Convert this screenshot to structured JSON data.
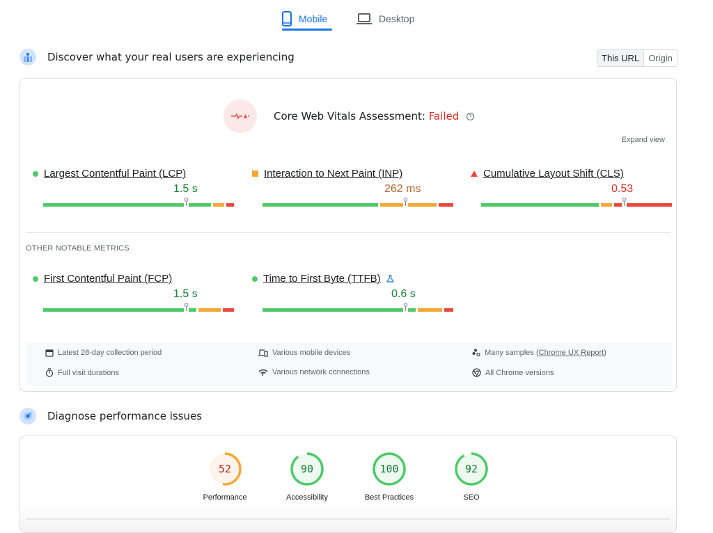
{
  "tabs": [
    {
      "label": "Mobile",
      "icon": "smartphone-icon",
      "active": true
    },
    {
      "label": "Desktop",
      "icon": "laptop-icon",
      "active": false
    }
  ],
  "field_section": {
    "title": "Discover what your real users are experiencing",
    "toggle": [
      {
        "label": "This URL",
        "active": true
      },
      {
        "label": "Origin",
        "active": false
      }
    ],
    "assessment": {
      "prefix": "Core Web Vitals Assessment:",
      "status": "Failed",
      "status_color": "#d93025"
    },
    "expand_label": "Expand view",
    "core_metrics": [
      {
        "name": "Largest Contentful Paint (LCP)",
        "value": "1.5 s",
        "rating": "good",
        "color": "#188038",
        "distribution": {
          "good_pct": 90,
          "ni_pct": 6,
          "poor_pct": 4
        },
        "marker_pct": 75
      },
      {
        "name": "Interaction to Next Paint (INP)",
        "value": "262 ms",
        "rating": "needs-improvement",
        "color": "#b7652c",
        "distribution": {
          "good_pct": 62,
          "ni_pct": 30,
          "poor_pct": 8
        },
        "marker_pct": 75
      },
      {
        "name": "Cumulative Layout Shift (CLS)",
        "value": "0.53",
        "rating": "poor",
        "color": "#d93025",
        "distribution": {
          "good_pct": 63,
          "ni_pct": 6,
          "poor_pct": 31
        },
        "marker_pct": 75
      }
    ],
    "other_heading": "OTHER NOTABLE METRICS",
    "other_metrics": [
      {
        "name": "First Contentful Paint (FCP)",
        "value": "1.5 s",
        "rating": "good",
        "color": "#188038",
        "distribution": {
          "good_pct": 82,
          "ni_pct": 12,
          "poor_pct": 6
        },
        "marker_pct": 75
      },
      {
        "name": "Time to First Byte (TTFB)",
        "value": "0.6 s",
        "rating": "good",
        "color": "#188038",
        "experimental": true,
        "distribution": {
          "good_pct": 82,
          "ni_pct": 13,
          "poor_pct": 5
        },
        "marker_pct": 75
      }
    ],
    "info": [
      {
        "icon": "calendar-icon",
        "text": "Latest 28-day collection period"
      },
      {
        "icon": "devices-icon",
        "text": "Various mobile devices"
      },
      {
        "icon": "samples-icon",
        "text": "Many samples (",
        "link": "Chrome UX Report",
        "suffix": ")"
      },
      {
        "icon": "timer-icon",
        "text": "Full visit durations"
      },
      {
        "icon": "wifi-icon",
        "text": "Various network connections"
      },
      {
        "icon": "chrome-icon",
        "text": "All Chrome versions"
      }
    ]
  },
  "lab_section": {
    "title": "Diagnose performance issues",
    "scores": [
      {
        "label": "Performance",
        "score": 52,
        "color": "#f4a836",
        "text_color": "#c5221f",
        "bg": "#fff4eb"
      },
      {
        "label": "Accessibility",
        "score": 90,
        "color": "#4fc96b",
        "text_color": "#188038",
        "bg": "#eef9f0"
      },
      {
        "label": "Best Practices",
        "score": 100,
        "color": "#4fc96b",
        "text_color": "#188038",
        "bg": "#eef9f0"
      },
      {
        "label": "SEO",
        "score": 92,
        "color": "#4fc96b",
        "text_color": "#188038",
        "bg": "#eef9f0"
      }
    ]
  }
}
